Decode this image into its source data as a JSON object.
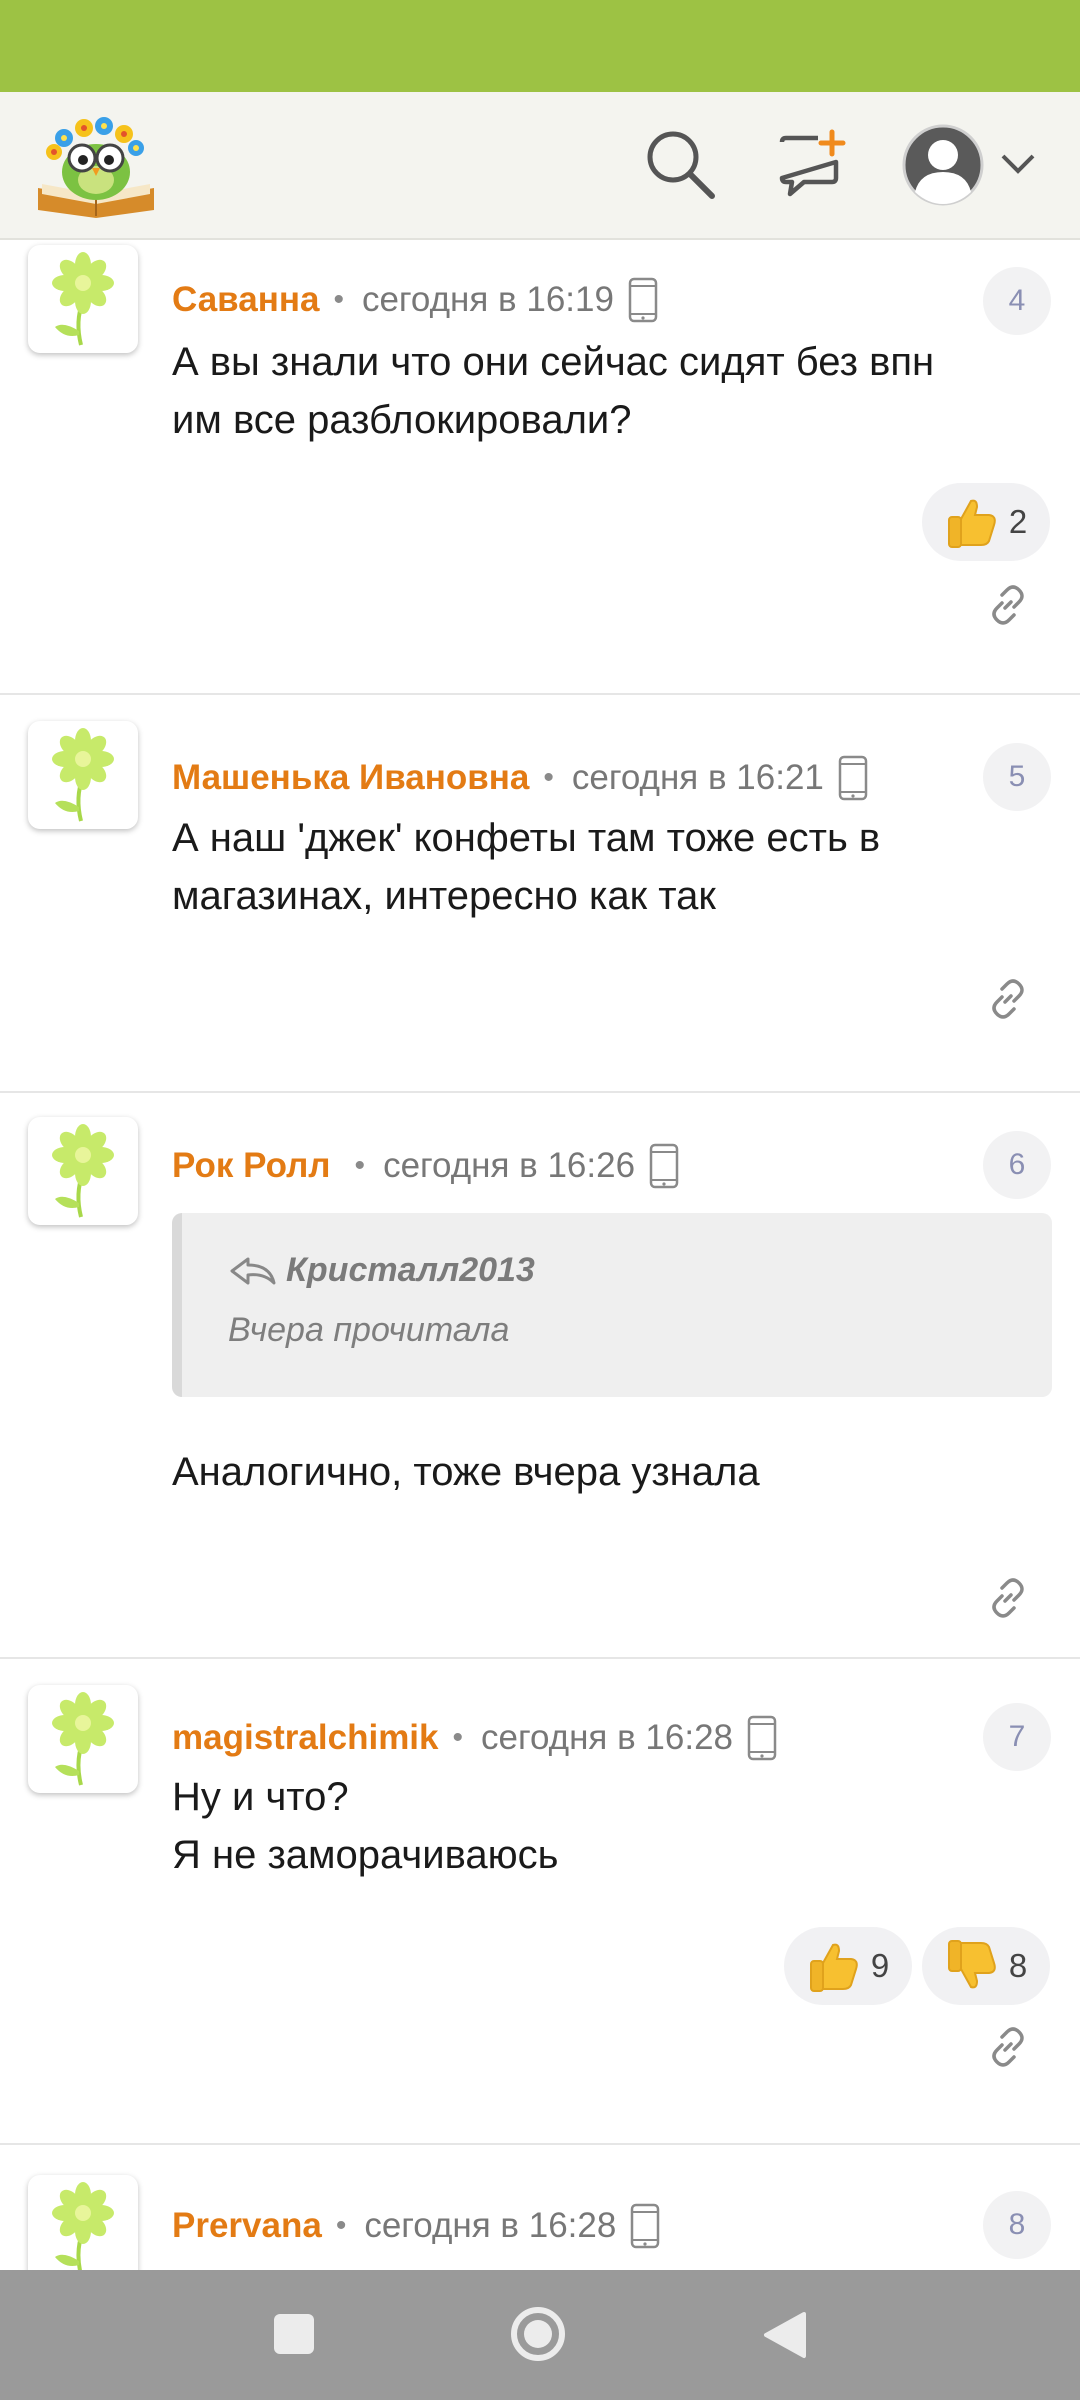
{
  "header": {
    "logo_icon": "owl-with-flowers-on-book-logo",
    "search_icon": "search-icon",
    "new_topic_icon": "chat-plus-icon",
    "avatar_icon": "user-avatar-icon",
    "menu_icon": "chevron-down-icon"
  },
  "colors": {
    "status_bar": "#9dc244",
    "author": "#e37b14",
    "comment_number": "#8a8fb3",
    "nav_bar": "#9a9a9a"
  },
  "comments": [
    {
      "author": "Саванна",
      "date": "сегодня в 16:19",
      "number": "4",
      "text": [
        "А вы знали что они сейчас сидят без впн",
        "им все разблокировали?"
      ],
      "reactions": [
        {
          "type": "like",
          "count": "2"
        }
      ]
    },
    {
      "author": "Машенька Ивановна",
      "date": "сегодня в 16:21",
      "number": "5",
      "text": [
        "А наш 'джек' конфеты там тоже есть в",
        "магазинах, интересно как так"
      ],
      "reactions": []
    },
    {
      "author": "Рок Ролл",
      "date": "сегодня в 16:26",
      "number": "6",
      "quote": {
        "author": "Кристалл2013",
        "text": "Вчера прочитала"
      },
      "text": [
        "Аналогично, тоже вчера узнала"
      ],
      "reactions": []
    },
    {
      "author": "magistralchimik",
      "date": "сегодня в 16:28",
      "number": "7",
      "text": [
        "Ну и что?",
        "Я не заморачиваюсь"
      ],
      "reactions": [
        {
          "type": "like",
          "count": "9"
        },
        {
          "type": "dislike",
          "count": "8"
        }
      ]
    },
    {
      "author": "Prervana",
      "date": "сегодня в 16:28",
      "number": "8",
      "text": [],
      "reactions": []
    }
  ],
  "navigation": {
    "recent_apps_icon": "square-icon",
    "home_icon": "circle-home-icon",
    "back_icon": "triangle-back-icon"
  }
}
